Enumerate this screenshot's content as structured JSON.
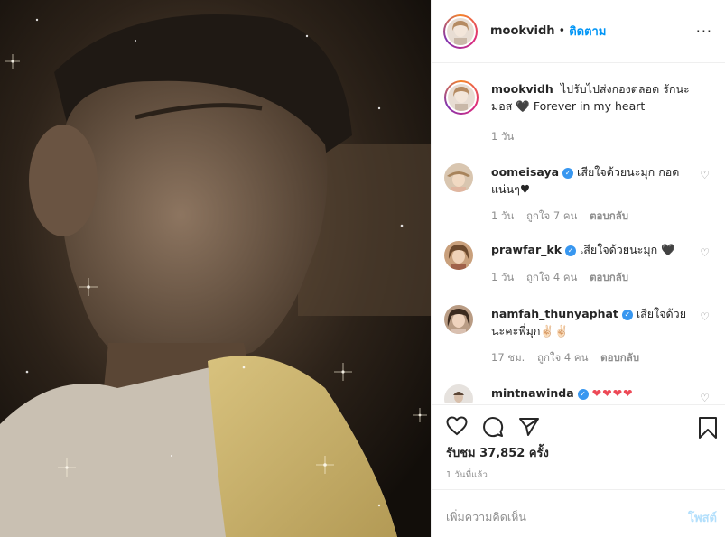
{
  "post": {
    "username": "mookvidh",
    "separator": "•",
    "follow_label": "ติดตาม",
    "more_label": "···"
  },
  "caption": {
    "username": "mookvidh",
    "text": "ไปรับไปส่งกองตลอด รักนะมอส 🖤 Forever in my heart",
    "time": "1 วัน"
  },
  "comments": [
    {
      "username": "oomeisaya",
      "verified": true,
      "text": "เสียใจด้วยนะมุก กอดแน่นๆ♥",
      "time": "1 วัน",
      "likes": "ถูกใจ 7 คน",
      "reply": "ตอบกลับ"
    },
    {
      "username": "prawfar_kk",
      "verified": true,
      "text": "เสียใจด้วยนะมุก 🖤",
      "time": "1 วัน",
      "likes": "ถูกใจ 4 คน",
      "reply": "ตอบกลับ"
    },
    {
      "username": "namfah_thunyaphat",
      "verified": true,
      "text": "เสียใจด้วยนะคะพี่มุก✌🏻✌🏻",
      "time": "17 ชม.",
      "likes": "ถูกใจ 4 คน",
      "reply": "ตอบกลับ"
    },
    {
      "username": "mintnawinda",
      "verified": true,
      "text": "❤❤❤❤"
    }
  ],
  "actions": {
    "views": "รับชม 37,852 ครั้ง",
    "posted_time": "1 วันที่แล้ว"
  },
  "composer": {
    "placeholder": "เพิ่มความคิดเห็น",
    "post_label": "โพสต์"
  }
}
